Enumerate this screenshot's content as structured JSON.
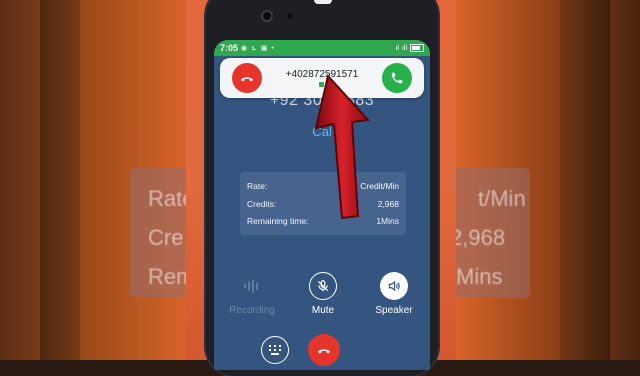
{
  "status_bar": {
    "time": "7:05"
  },
  "incoming_call": {
    "number": "+402872591571"
  },
  "call_screen": {
    "dialed_number": "+92 303 1883",
    "calling_label": "Cal"
  },
  "info_card": {
    "rows": [
      {
        "label": "Rate:",
        "value": "Credit/Min"
      },
      {
        "label": "Credits:",
        "value": "2,968"
      },
      {
        "label": "Remaining time:",
        "value": "1Mins"
      }
    ]
  },
  "background_text": {
    "rate": "Rate",
    "rate_value": "t/Min",
    "credits": "Cre",
    "credits_value": "2,968",
    "remaining": "Rem",
    "remaining_value": "Mins"
  },
  "controls": {
    "recording": "Recording",
    "mute": "Mute",
    "speaker": "Speaker"
  },
  "colors": {
    "accept": "#27b14b",
    "decline": "#e5352b",
    "status_bar": "#2fa84f",
    "screen": "#34557f",
    "arrow": "#b8141a"
  }
}
